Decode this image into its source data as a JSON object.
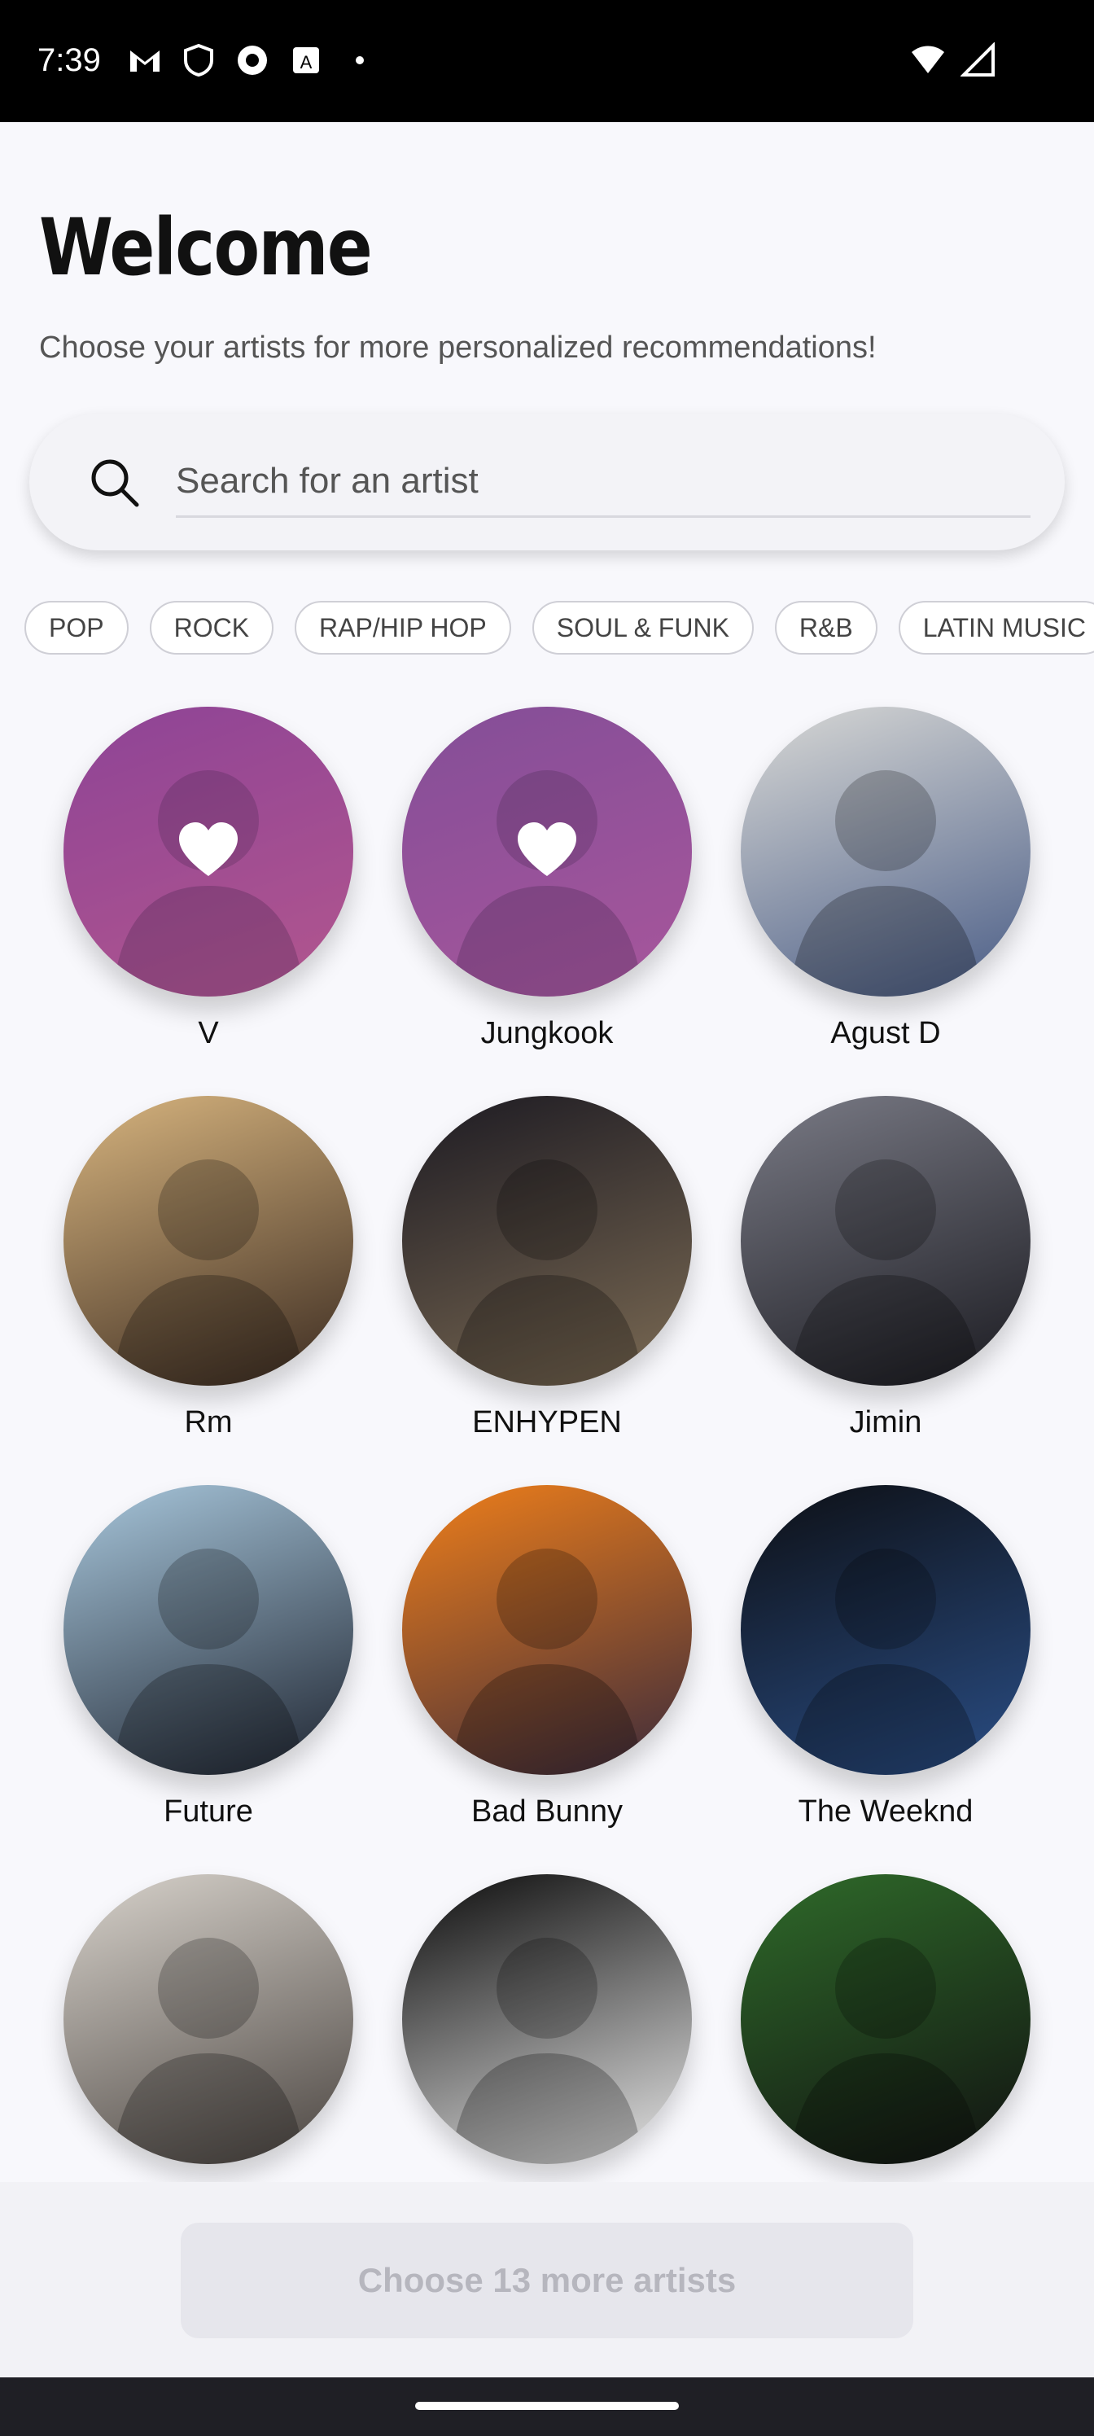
{
  "status_bar": {
    "time": "7:39",
    "icons": [
      "gmail-icon",
      "shield-icon",
      "app-icon",
      "a-box-icon",
      "dot-icon"
    ],
    "right_icons": [
      "wifi-icon",
      "signal-icon"
    ]
  },
  "header": {
    "title": "Welcome",
    "subtitle": "Choose your artists for more personalized recommendations!"
  },
  "search": {
    "placeholder": "Search for an artist"
  },
  "genres": [
    "POP",
    "ROCK",
    "RAP/HIP HOP",
    "SOUL & FUNK",
    "R&B",
    "LATIN MUSIC"
  ],
  "artists": [
    {
      "name": "V",
      "selected": true,
      "colors": [
        "#8a3d86",
        "#c25a7a"
      ]
    },
    {
      "name": "Jungkook",
      "selected": true,
      "colors": [
        "#7a4d88",
        "#b25a8f"
      ]
    },
    {
      "name": "Agust D",
      "selected": false,
      "colors": [
        "#d9d9d6",
        "#495c86"
      ]
    },
    {
      "name": "Rm",
      "selected": false,
      "colors": [
        "#d8b57f",
        "#3a2a20"
      ]
    },
    {
      "name": "ENHYPEN",
      "selected": false,
      "colors": [
        "#1c1a22",
        "#7c6b54"
      ]
    },
    {
      "name": "Jimin",
      "selected": false,
      "colors": [
        "#7a7b86",
        "#1a1a20"
      ]
    },
    {
      "name": "Future",
      "selected": false,
      "colors": [
        "#a8c7dc",
        "#1e2430"
      ]
    },
    {
      "name": "Bad Bunny",
      "selected": false,
      "colors": [
        "#f07f1a",
        "#3a2a3c"
      ]
    },
    {
      "name": "The Weeknd",
      "selected": false,
      "colors": [
        "#0d0f14",
        "#2a4e86"
      ]
    },
    {
      "name": "",
      "selected": false,
      "colors": [
        "#d8d3cc",
        "#4a4440"
      ]
    },
    {
      "name": "",
      "selected": false,
      "colors": [
        "#0a0a0a",
        "#e8e8e8"
      ]
    },
    {
      "name": "",
      "selected": false,
      "colors": [
        "#2f6b2a",
        "#111111"
      ]
    }
  ],
  "cta": {
    "label": "Choose 13 more artists"
  }
}
